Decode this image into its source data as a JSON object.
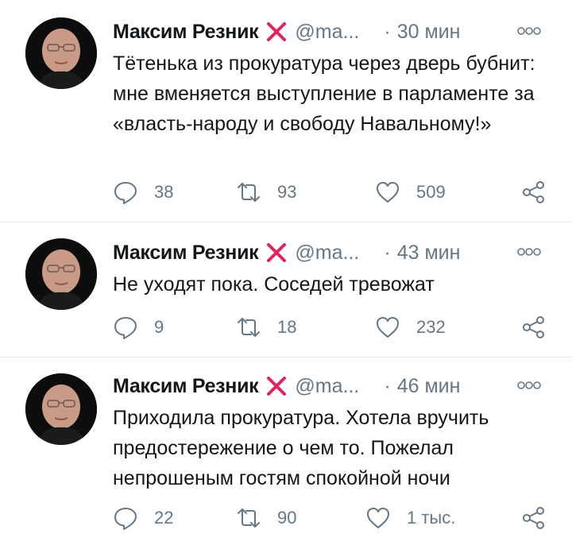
{
  "tweets": [
    {
      "author": {
        "name": "Максим Резник",
        "handle": "@ma...",
        "badge_icon": "red-x-icon"
      },
      "time": "30 мин",
      "dot": "·",
      "text": "Тётенька из прокуратура через дверь бубнит: мне вменяется выступление в парламенте за «власть-народу и свободу Навальному!»",
      "stats": {
        "replies": "38",
        "retweets": "93",
        "likes": "509"
      }
    },
    {
      "author": {
        "name": "Максим Резник",
        "handle": "@ma...",
        "badge_icon": "red-x-icon"
      },
      "time": "43 мин",
      "dot": "·",
      "text": "Не уходят пока. Соседей тревожат",
      "stats": {
        "replies": "9",
        "retweets": "18",
        "likes": "232"
      }
    },
    {
      "author": {
        "name": "Максим Резник",
        "handle": "@ma...",
        "badge_icon": "red-x-icon"
      },
      "time": "46 мин",
      "dot": "·",
      "text": "Приходила прокуратура. Хотела вручить предостережение о чем то. Пожелал непрошеным гостям спокойной ночи",
      "stats": {
        "replies": "22",
        "retweets": "90",
        "likes": "1 тыс."
      }
    }
  ],
  "colors": {
    "text": "#14171a",
    "secondary": "#657786",
    "badge": "#e0245e",
    "divider": "#e6ecf0"
  }
}
